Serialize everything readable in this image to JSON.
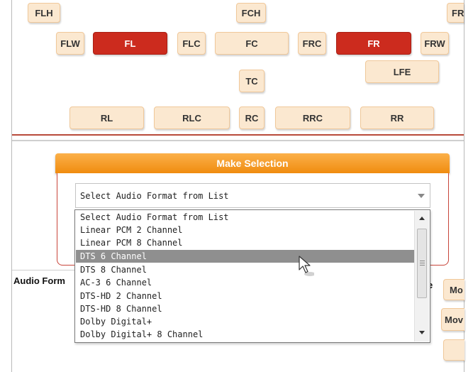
{
  "speakers": {
    "flh": "FLH",
    "fch": "FCH",
    "fr_cut": "FR",
    "flw": "FLW",
    "fl": "FL",
    "flc": "FLC",
    "fc": "FC",
    "frc": "FRC",
    "fr": "FR",
    "frw": "FRW",
    "lfe": "LFE",
    "tc": "TC",
    "rl": "RL",
    "rlc": "RLC",
    "rc": "RC",
    "rrc": "RRC",
    "rr": "RR",
    "selected": [
      "FL",
      "FR"
    ],
    "colors": {
      "selected": "#cc2b1e",
      "unselected": "#fbe8d0"
    }
  },
  "selection": {
    "header": "Make Selection",
    "select_value": "Select Audio Format from List",
    "options": [
      "Select Audio Format from List",
      "Linear PCM 2 Channel",
      "Linear PCM 8 Channel",
      "DTS 6 Channel",
      "DTS 8 Channel",
      "AC-3 6 Channel",
      "DTS-HD 2 Channel",
      "DTS-HD 8 Channel",
      "Dolby Digital+",
      "Dolby Digital+ 8 Channel"
    ],
    "highlighted": "DTS 6 Channel",
    "accent_color": "#f39a1f"
  },
  "lower": {
    "audio_format_label": "Audio Form",
    "trailing_char": "e",
    "move_btn_1": "Mo",
    "move_btn_2": "Mov"
  }
}
